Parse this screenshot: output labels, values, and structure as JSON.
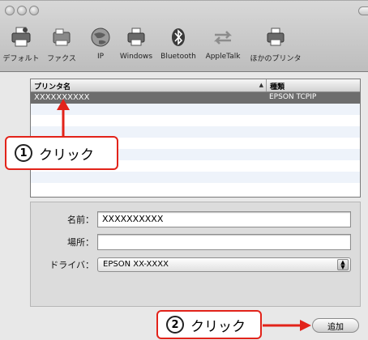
{
  "toolbar": {
    "items": [
      {
        "label": "デフォルト",
        "icon": "default-printer-icon"
      },
      {
        "label": "ファクス",
        "icon": "fax-icon"
      },
      {
        "label": "IP",
        "icon": "globe-icon"
      },
      {
        "label": "Windows",
        "icon": "windows-printer-icon"
      },
      {
        "label": "Bluetooth",
        "icon": "bluetooth-icon"
      },
      {
        "label": "AppleTalk",
        "icon": "appletalk-arrows-icon"
      },
      {
        "label": "ほかのプリンタ",
        "icon": "other-printer-icon"
      }
    ]
  },
  "printer_list": {
    "columns": [
      "プリンタ名",
      "種類"
    ],
    "rows": [
      {
        "name": "XXXXXXXXXX",
        "kind": "EPSON TCPIP",
        "selected": true
      }
    ]
  },
  "form": {
    "name_label": "名前：",
    "name_value": "XXXXXXXXXX",
    "location_label": "場所：",
    "location_value": "",
    "driver_label": "ドライバ：",
    "driver_value": "EPSON XX-XXXX"
  },
  "add_button_label": "追加",
  "annotations": {
    "step1_number": "1",
    "step1_text": "クリック",
    "step2_number": "2",
    "step2_text": "クリック",
    "color": "#e2231a"
  }
}
